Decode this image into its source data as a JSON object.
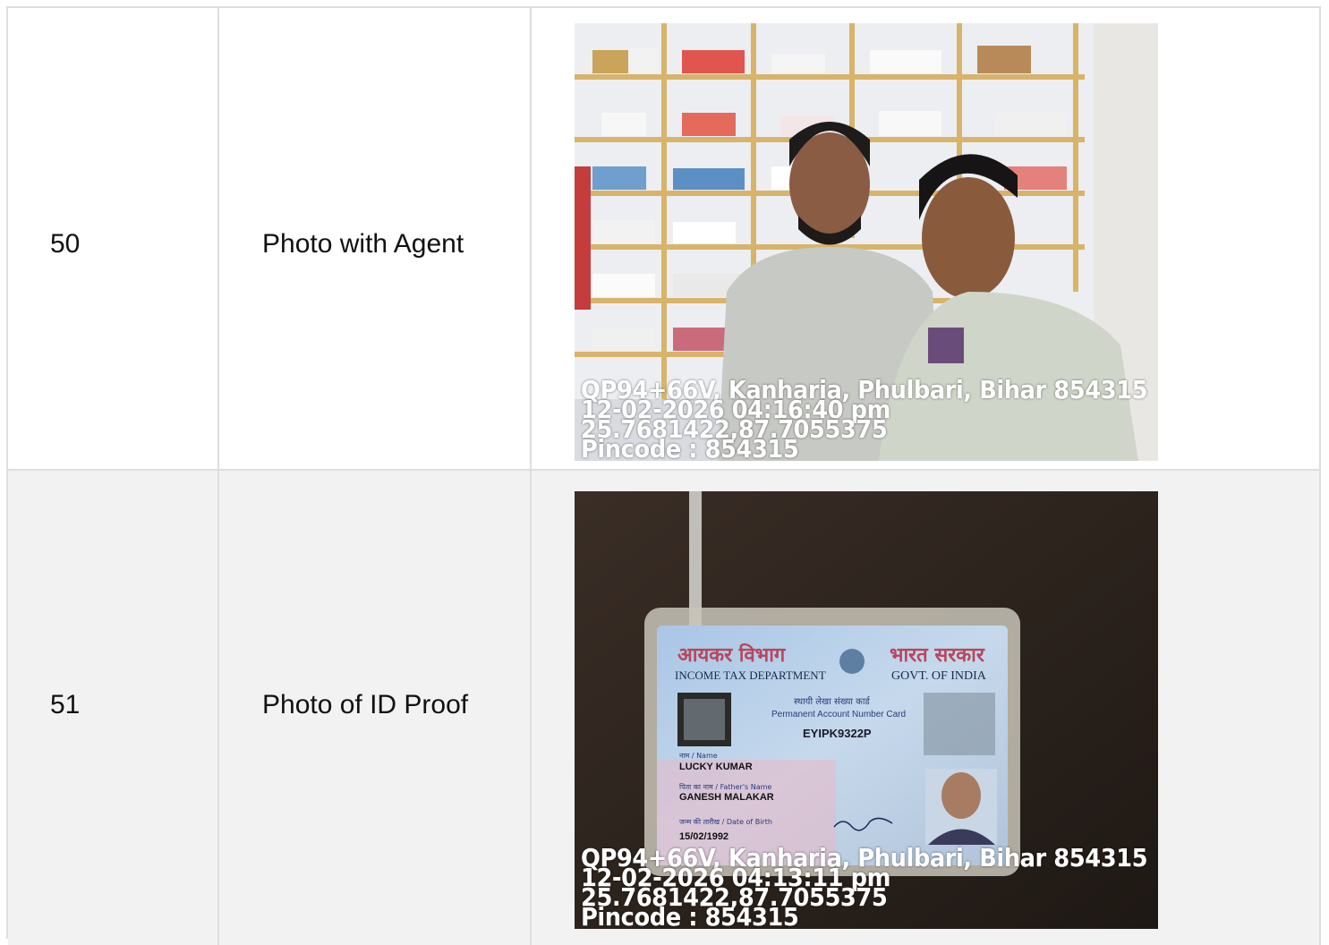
{
  "rows": [
    {
      "number": "50",
      "label": "Photo with Agent",
      "overlay": {
        "address": "QP94+66V, Kanharia, Phulbari, Bihar 854315",
        "datetime": "12-02-2026 04:16:40 pm",
        "coords": "25.7681422,87.7055375",
        "pincode": "Pincode : 854315"
      }
    },
    {
      "number": "51",
      "label": "Photo of ID Proof",
      "overlay": {
        "address": "QP94+66V, Kanharia, Phulbari, Bihar 854315",
        "datetime": "12-02-2026 04:13:11 pm",
        "coords": "25.7681422,87.7055375",
        "pincode": "Pincode : 854315"
      },
      "card": {
        "dept_hindi": "आयकर विभाग",
        "dept_english": "INCOME TAX DEPARTMENT",
        "govt_hindi": "भारत सरकार",
        "govt_english": "GOVT. OF INDIA",
        "card_title_hindi": "स्थायी लेखा संख्या कार्ड",
        "card_title_english": "Permanent Account Number Card",
        "pan_number": "EYIPK9322P",
        "name_caption": "नाम / Name",
        "name": "LUCKY KUMAR",
        "father_caption": "पिता का नाम / Father's Name",
        "father_name": "GANESH MALAKAR",
        "dob_caption": "जन्म की तारीख / Date of Birth",
        "dob": "15/02/1992"
      }
    }
  ]
}
